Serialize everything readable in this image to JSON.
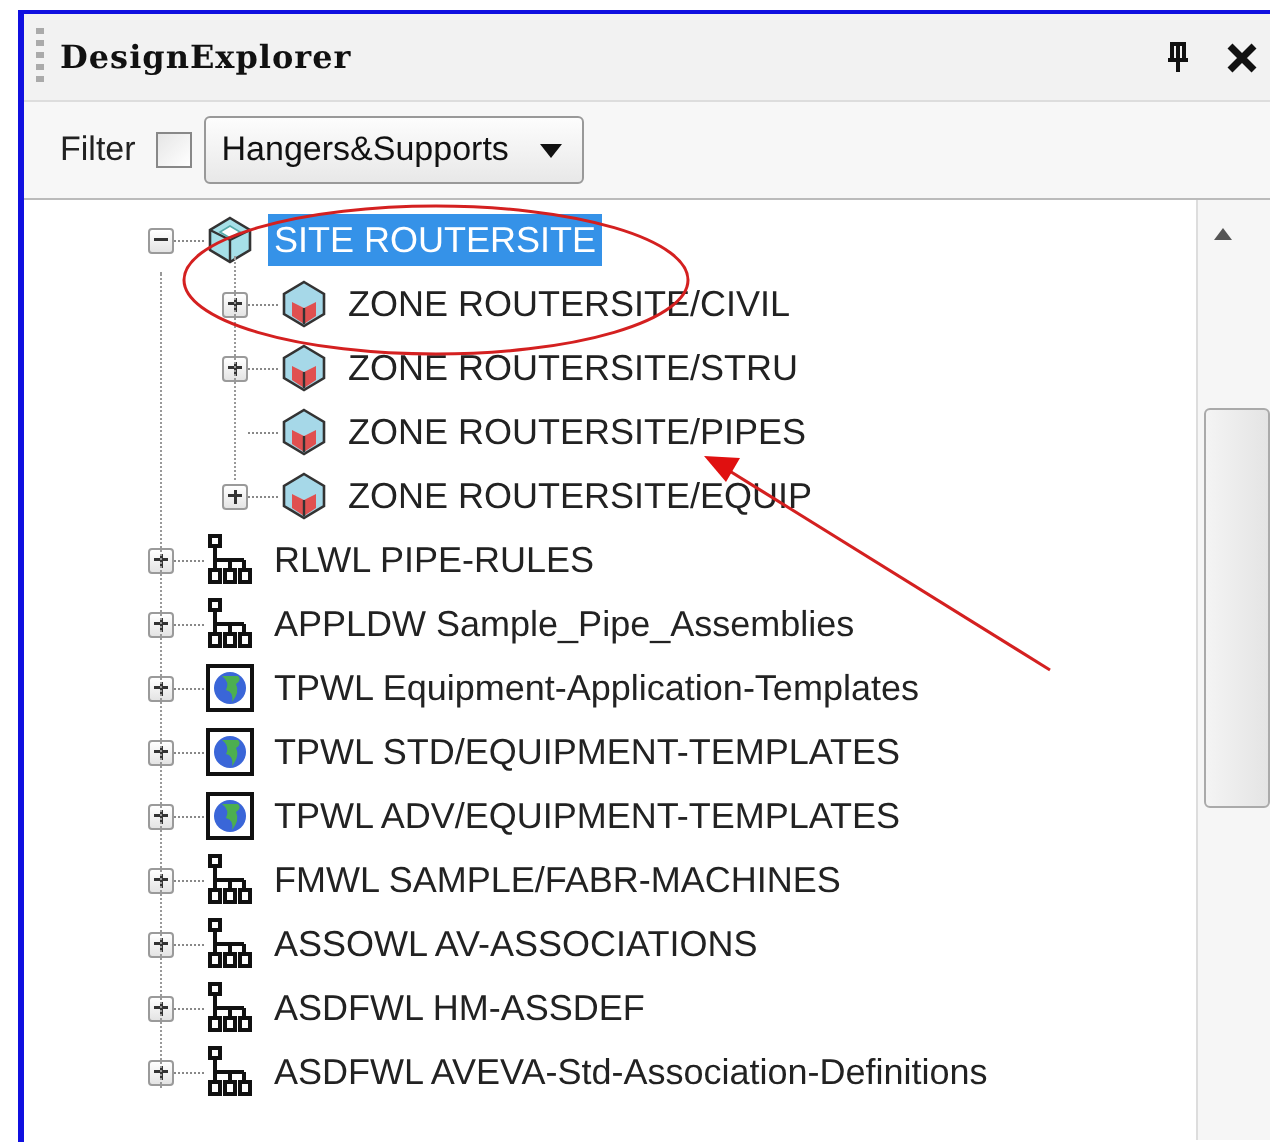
{
  "window": {
    "title": "DesignExplorer"
  },
  "filter": {
    "label": "Filter",
    "checked": false,
    "value": "Hangers&Supports"
  },
  "tree": [
    {
      "label": "SITE ROUTERSITE",
      "kind": "site",
      "expanded": true,
      "selected": true,
      "children": [
        {
          "label": "ZONE ROUTERSITE/CIVIL",
          "kind": "zone",
          "expanded": false,
          "selected": false
        },
        {
          "label": "ZONE ROUTERSITE/STRU",
          "kind": "zone",
          "expanded": false,
          "selected": false
        },
        {
          "label": "ZONE ROUTERSITE/PIPES",
          "kind": "zone",
          "selected": false
        },
        {
          "label": "ZONE ROUTERSITE/EQUIP",
          "kind": "zone",
          "expanded": false,
          "selected": false
        }
      ]
    },
    {
      "label": "RLWL PIPE-RULES",
      "kind": "hierarchy",
      "expanded": false,
      "selected": false
    },
    {
      "label": "APPLDW Sample_Pipe_Assemblies",
      "kind": "hierarchy",
      "expanded": false,
      "selected": false
    },
    {
      "label": "TPWL Equipment-Application-Templates",
      "kind": "globe",
      "expanded": false,
      "selected": false
    },
    {
      "label": "TPWL STD/EQUIPMENT-TEMPLATES",
      "kind": "globe",
      "expanded": false,
      "selected": false
    },
    {
      "label": "TPWL ADV/EQUIPMENT-TEMPLATES",
      "kind": "globe",
      "expanded": false,
      "selected": false
    },
    {
      "label": "FMWL SAMPLE/FABR-MACHINES",
      "kind": "hierarchy",
      "expanded": false,
      "selected": false
    },
    {
      "label": "ASSOWL AV-ASSOCIATIONS",
      "kind": "hierarchy",
      "expanded": false,
      "selected": false
    },
    {
      "label": "ASDFWL HM-ASSDEF",
      "kind": "hierarchy",
      "expanded": false,
      "selected": false
    },
    {
      "label": "ASDFWL AVEVA-Std-Association-Definitions",
      "kind": "hierarchy",
      "expanded": false,
      "selected": false
    }
  ]
}
